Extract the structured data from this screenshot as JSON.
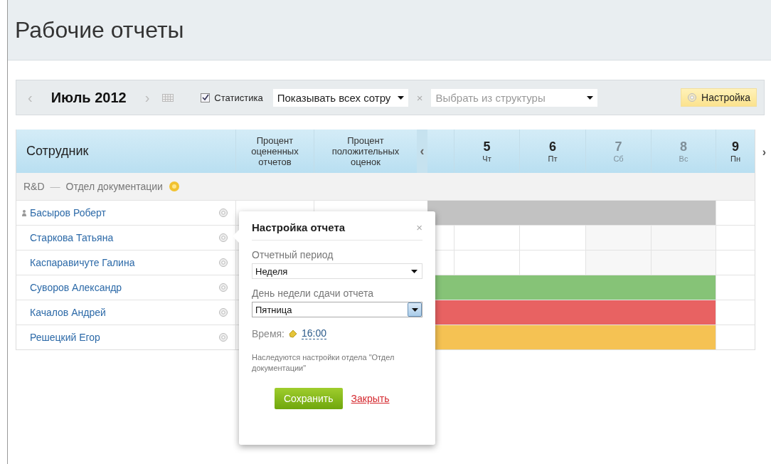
{
  "page": {
    "title": "Рабочие отчеты"
  },
  "toolbar": {
    "prev": "‹",
    "month": "Июль 2012",
    "next": "›",
    "statistics": {
      "label": "Статистика",
      "checked": true
    },
    "employee_filter": {
      "value": "Показывать всех сотру"
    },
    "clear": "×",
    "structure": {
      "placeholder": "Выбрать из структуры"
    },
    "settings_button": "Настройка"
  },
  "table": {
    "columns": [
      "Сотрудник",
      "Процент оцененных отчетов",
      "Процент положительных оценок"
    ],
    "prev": "‹",
    "next": "›",
    "days": [
      {
        "number": "5",
        "weekday": "Чт",
        "weekend": false
      },
      {
        "number": "6",
        "weekday": "Пт",
        "weekend": false
      },
      {
        "number": "7",
        "weekday": "Сб",
        "weekend": true
      },
      {
        "number": "8",
        "weekday": "Вс",
        "weekend": true
      },
      {
        "number": "9",
        "weekday": "Пн",
        "weekend": false
      }
    ],
    "group": {
      "company": "R&D",
      "separator": "—",
      "department": "Отдел документации"
    },
    "rows": [
      {
        "name": "Басыров Роберт",
        "head": true,
        "color": "#c2c2c2"
      },
      {
        "name": "Старкова Татьяна",
        "head": false
      },
      {
        "name": "Каспаравичуте Галина",
        "head": false
      },
      {
        "name": "Суворов Александр",
        "head": false,
        "color": "#86c377"
      },
      {
        "name": "Качалов Андрей",
        "head": false,
        "color": "#e86262"
      },
      {
        "name": "Решецкий Егор",
        "head": false,
        "color": "#f5c253"
      }
    ]
  },
  "popup": {
    "title": "Настройка отчета",
    "close": "×",
    "period_label": "Отчетный период",
    "period_value": "Неделя",
    "day_label": "День недели сдачи отчета",
    "day_value": "Пятница",
    "time_label": "Время:",
    "time_value": "16:00",
    "note": "Наследуются настройки отдела \"Отдел документации\"",
    "save": "Сохранить",
    "cancel": "Закрыть"
  }
}
